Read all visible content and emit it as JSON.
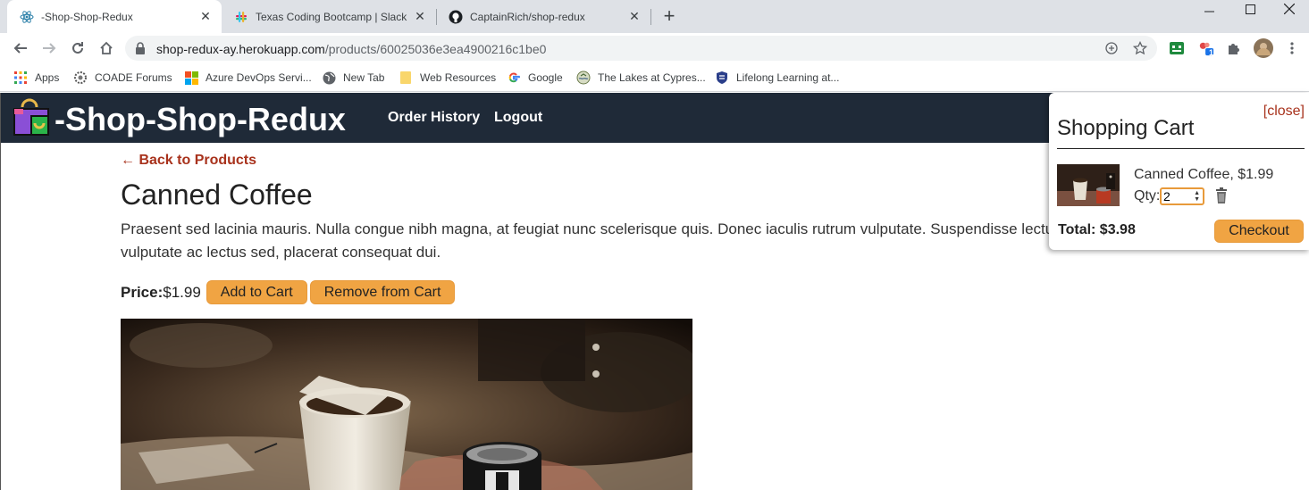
{
  "browser": {
    "tabs": [
      {
        "title": "-Shop-Shop-Redux",
        "active": true
      },
      {
        "title": "Texas Coding Bootcamp | Slack",
        "active": false
      },
      {
        "title": "CaptainRich/shop-redux",
        "active": false
      }
    ],
    "url": {
      "host": "shop-redux-ay.herokuapp.com",
      "path": "/products/60025036e3ea4900216c1be0"
    },
    "bookmarks": [
      {
        "label": "Apps",
        "icon": "apps-grid-icon"
      },
      {
        "label": "COADE Forums",
        "icon": "coade-icon"
      },
      {
        "label": "Azure DevOps Servi...",
        "icon": "microsoft-icon"
      },
      {
        "label": "New Tab",
        "icon": "globe-icon"
      },
      {
        "label": "Web Resources",
        "icon": "folder-icon"
      },
      {
        "label": "Google",
        "icon": "google-icon"
      },
      {
        "label": "The Lakes at Cypres...",
        "icon": "lakes-icon"
      },
      {
        "label": "Lifelong Learning at...",
        "icon": "shield-icon"
      }
    ],
    "extension_badge": "1"
  },
  "header": {
    "brand": "-Shop-Shop-Redux",
    "links": [
      "Order History",
      "Logout"
    ]
  },
  "product": {
    "back_link": "← Back to Products",
    "name": "Canned Coffee",
    "description": "Praesent sed lacinia mauris. Nulla congue nibh magna, at feugiat nunc scelerisque quis. Donec iaculis rutrum vulputate. Suspendisse lectus sem, vulputate ac lectus sed, placerat consequat dui.",
    "price_label": "Price:",
    "price": "$1.99",
    "add_label": "Add to Cart",
    "remove_label": "Remove from Cart"
  },
  "cart": {
    "close_label": "[close]",
    "title": "Shopping Cart",
    "item": {
      "name_price": "Canned Coffee, $1.99",
      "qty_label": "Qty:",
      "qty": "2"
    },
    "total": "Total: $3.98",
    "checkout_label": "Checkout"
  },
  "colors": {
    "header_bg": "#1f2a38",
    "accent_orange": "#f0a443",
    "link_red": "#a8321c"
  }
}
